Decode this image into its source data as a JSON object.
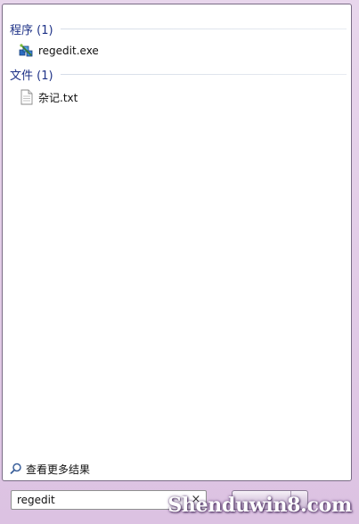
{
  "sections": [
    {
      "header": "程序 (1)",
      "items": [
        {
          "label": "regedit.exe",
          "icon": "registry-editor-icon"
        }
      ]
    },
    {
      "header": "文件 (1)",
      "items": [
        {
          "label": "杂记.txt",
          "icon": "text-file-icon"
        }
      ]
    }
  ],
  "more_results": {
    "label": "查看更多结果",
    "icon": "search-icon"
  },
  "search": {
    "value": "regedit",
    "clear_glyph": "×"
  },
  "watermark": {
    "text": "Shenduwin8.com"
  },
  "colors": {
    "section_header": "#1e3287",
    "panel_background": "#ffffff",
    "frame_background": "#dcc2e2"
  }
}
